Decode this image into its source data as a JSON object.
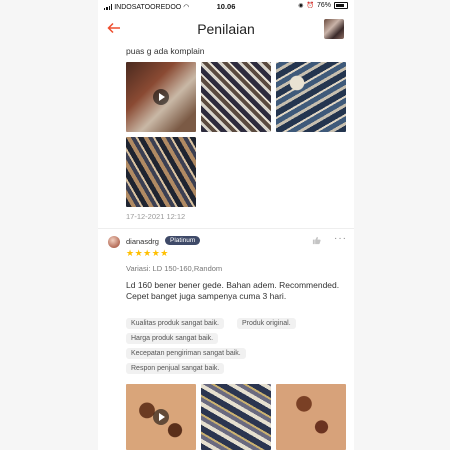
{
  "status_bar": {
    "carrier": "INDOSATOOREDOO",
    "time": "10.06",
    "battery": "76%"
  },
  "header": {
    "title": "Penilaian"
  },
  "review1": {
    "text_tail": "puas g ada komplain",
    "date": "17-12-2021 12:12"
  },
  "review2": {
    "username": "dianasdrg",
    "badge": "Platinum",
    "rating": 5,
    "stars": "★★★★★",
    "variation": "Variasi: LD 150-160,Random",
    "comment": "Ld 160 bener bener gede. Bahan adem. Recommended. Cepet banget juga sampenya cuma 3 hari.",
    "tags": [
      "Kualitas produk sangat baik.",
      "Produk original.",
      "Harga produk sangat baik.",
      "Kecepatan pengiriman sangat baik.",
      "Respon penjual sangat baik."
    ]
  },
  "icons": {
    "back": "back-arrow-icon",
    "play": "play-icon",
    "like": "thumbs-up-icon",
    "more": "more-options-icon"
  },
  "colors": {
    "accent": "#ee4d2d",
    "star": "#ffbf00",
    "badge": "#3f4a68"
  }
}
